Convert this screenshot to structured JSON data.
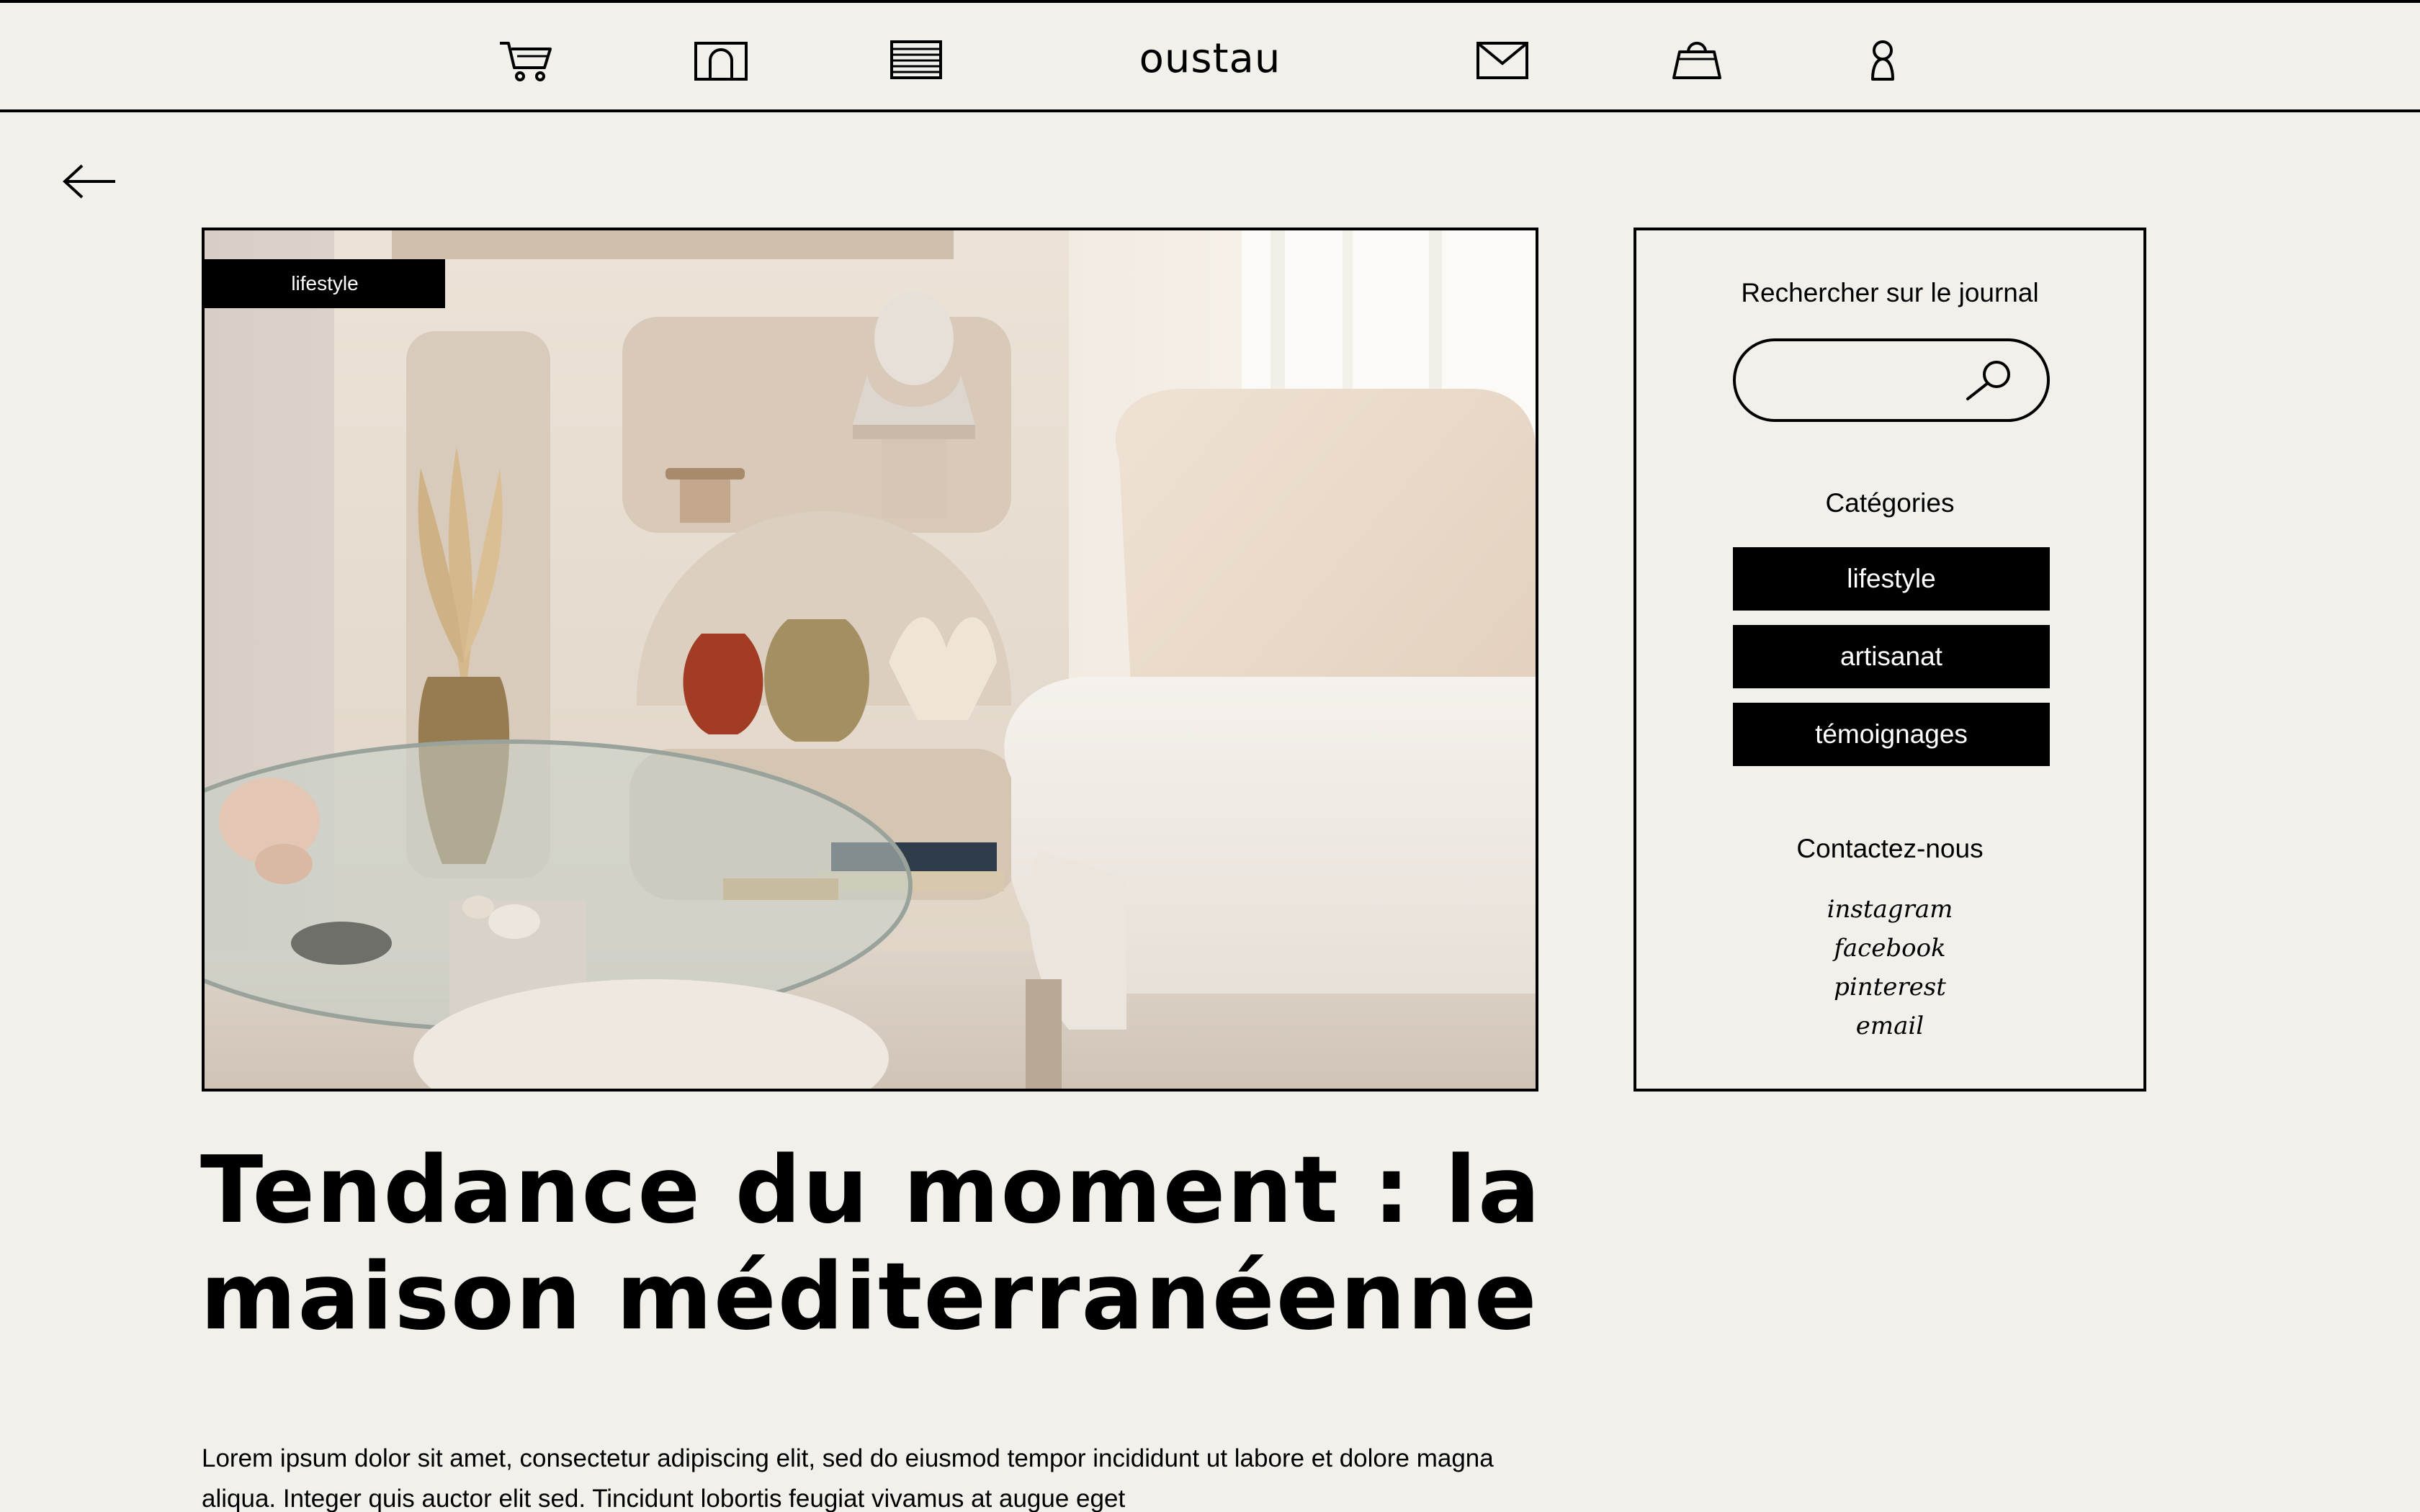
{
  "nav": {
    "brand": "oustau",
    "icons": [
      "cart-icon",
      "home-icon",
      "list-icon",
      "mail-icon",
      "bag-icon",
      "user-icon"
    ]
  },
  "hero": {
    "tag": "lifestyle"
  },
  "sidebar": {
    "search_heading": "Rechercher sur le journal",
    "search_placeholder": "",
    "categories_heading": "Catégories",
    "categories": [
      "lifestyle",
      "artisanat",
      "témoignages"
    ],
    "contact_heading": "Contactez-nous",
    "social_links": [
      "instagram",
      "facebook",
      "pinterest",
      "email"
    ]
  },
  "article": {
    "title": "Tendance du moment : la maison méditerranéenne",
    "body": "Lorem ipsum dolor sit amet, consectetur adipiscing elit, sed do eiusmod tempor incididunt ut labore et dolore magna aliqua. Integer quis auctor elit sed. Tincidunt lobortis feugiat vivamus at augue eget"
  },
  "colors": {
    "background": "#f1f0ea",
    "ink": "#000000"
  }
}
